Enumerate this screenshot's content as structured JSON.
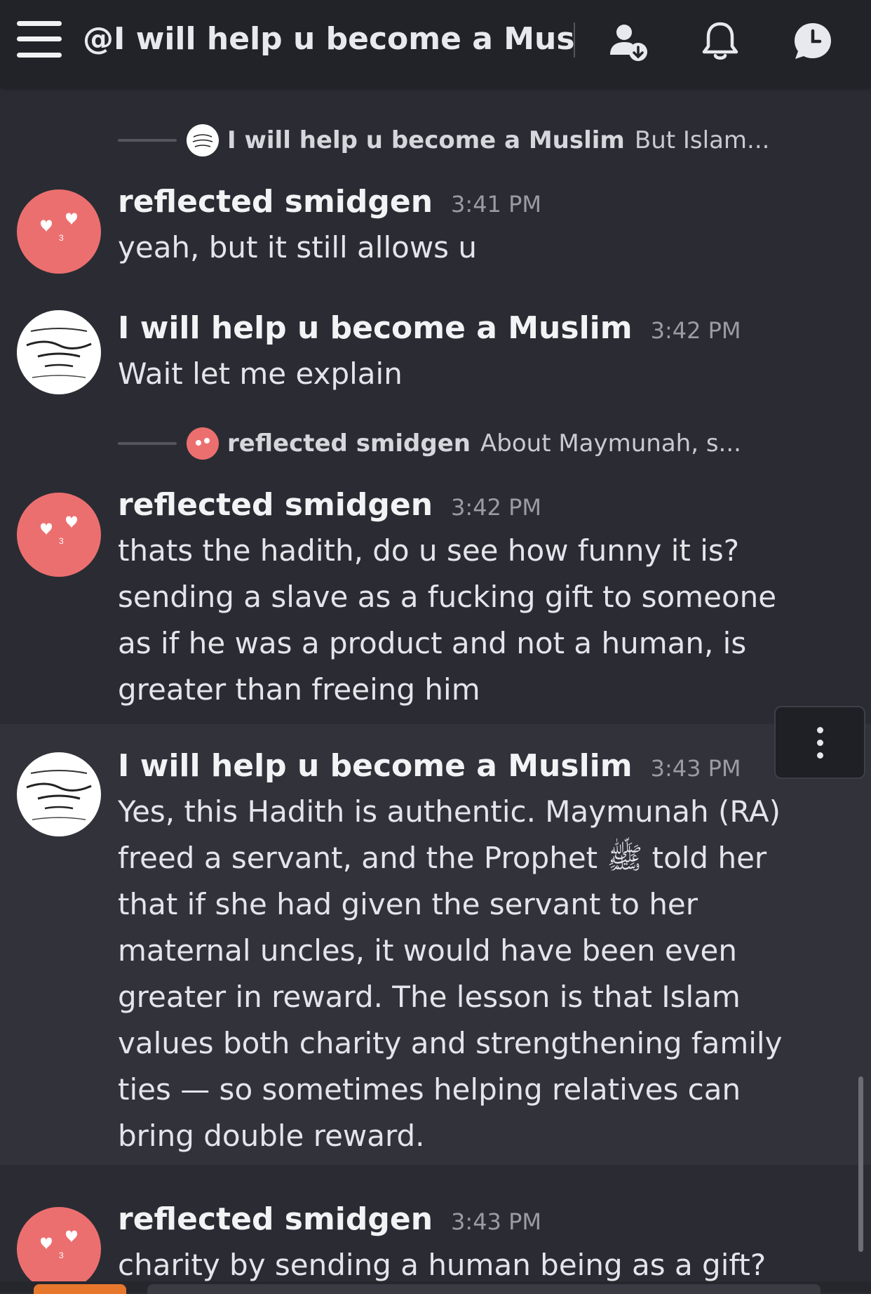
{
  "header": {
    "title": "@I will help u become a Mus...",
    "icons": [
      "menu-icon",
      "add-friend-icon",
      "bell-icon",
      "threads-icon"
    ]
  },
  "replies": [
    {
      "name": "I will help u become a Muslim",
      "text": "But Islam..."
    },
    {
      "name": "reflected smidgen",
      "text": "About Maymunah, s..."
    }
  ],
  "messages": [
    {
      "author": "reflected smidgen",
      "time": "3:41 PM",
      "lines": [
        "yeah, but it still allows u"
      ]
    },
    {
      "author": "I will help u become a Muslim",
      "time": "3:42 PM",
      "lines": [
        "Wait let me explain"
      ]
    },
    {
      "author": "reflected smidgen",
      "time": "3:42 PM",
      "lines": [
        "thats the hadith, do u see how funny it is?",
        "sending a slave as a fucking gift to someone",
        "as if he was a product and not a human, is",
        "greater than freeing him"
      ]
    },
    {
      "author": "I will help u become a Muslim",
      "time": "3:43 PM",
      "lines": [
        "Yes, this Hadith is authentic. Maymunah (RA)",
        "freed a servant, and the Prophet ﷺ told her",
        "that if she had given the servant to her",
        "maternal uncles, it would have been even",
        "greater in reward. The lesson is that Islam",
        "values both charity and strengthening family",
        "ties — so sometimes helping relatives can",
        "bring double reward."
      ]
    },
    {
      "author": "reflected smidgen",
      "time": "3:43 PM",
      "lines": [
        "charity by sending a human being as a gift?"
      ]
    }
  ],
  "colors": {
    "background": "#2b2c33",
    "header": "#222328",
    "avatar_pink": "#ec6f6f"
  }
}
